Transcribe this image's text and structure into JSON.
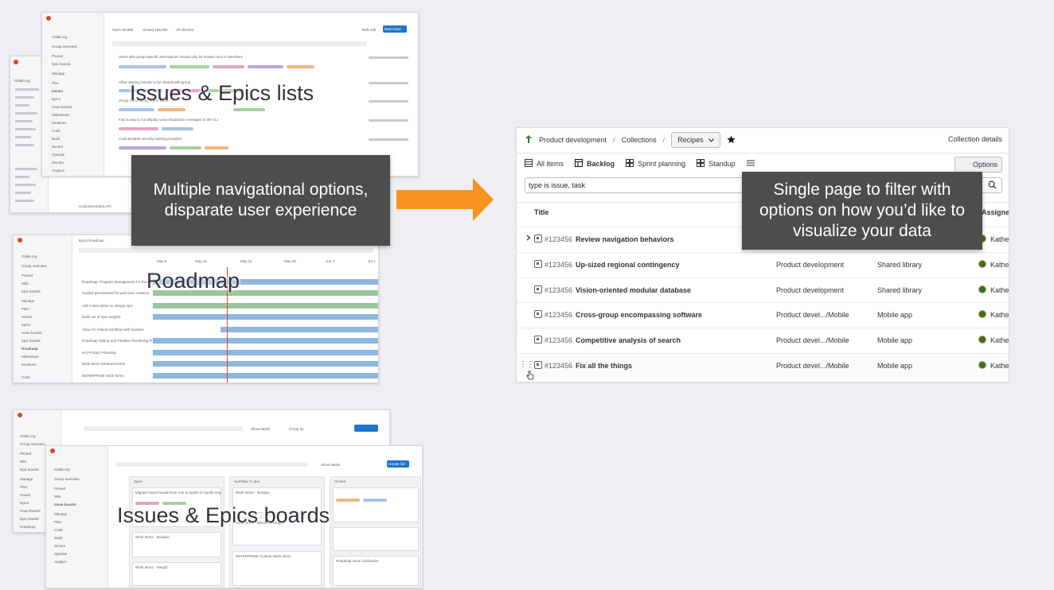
{
  "labels": {
    "issues_epics_lists": "Issues & Epics lists",
    "roadmap": "Roadmap",
    "issues_epics_boards": "Issues & Epics boards"
  },
  "callouts": {
    "left": "Multiple navigational options, disparate user experience",
    "right": "Single page to filter with options on how you’d like to visualize your data"
  },
  "colors": {
    "arrow": "#f7941d",
    "callout_bg": "#4d4d4d",
    "brand": "#e2432a",
    "accent_blue": "#1f75cb"
  },
  "mini_lists": {
    "sidebar_group": "Gitlab.org",
    "sidebar_items": [
      "Group overview",
      "Pinned",
      "Wiki",
      "Epic boards",
      "Manage",
      "Plan",
      "Issues",
      "Epics",
      "Issue boards",
      "Epic boards",
      "Roadmap",
      "Milestones",
      "Iterations",
      "Wiki",
      "Code",
      "Build",
      "Secure",
      "Operate",
      "Monitor",
      "Analyze"
    ],
    "header": {
      "new_issue_button": "New issue",
      "bulk_edit_button": "Bulk edit",
      "open_tab": "Open 85,888",
      "closed_tab": "Closed 168,056",
      "all_tab": "All 253,923"
    },
    "issue_titles": [
      "Users with group-specific permissions should only be shown once in Members",
      "Allow starting remote to be shared with group",
      "Group vulnerability report filters",
      "Find a way to not display some broadcast messages in the CLI",
      "Customizable security training providers",
      "Customers/Ultra API"
    ]
  },
  "mini_roadmap": {
    "title": "Epics Roadmap",
    "months": [
      "May 9",
      "May 16",
      "May 21",
      "May 28",
      "Jun 4",
      "Jul 1"
    ],
    "epics": [
      "Roadmap: Program Management for Roadmaps",
      "Guided permissions for work item creators",
      "Add a description to design epic",
      "Build out of epic weights",
      "Allow for refined workflow with lossless",
      "Roadmap Styling and Timeline Rendering Problems",
      "Hot Product Planning",
      "Work Items Enhancements",
      "ENTERPRISE Work Items"
    ]
  },
  "mini_boards": {
    "search_button": "Create list",
    "show_labels": "Show labels",
    "group_by": "Group by",
    "columns": [
      "Open",
      "workflow::in dev",
      "Closed"
    ],
    "cards": [
      "Migrate Issue boards from Vue to Apollo to Apollo only",
      "Work Items - Iteration",
      "Work Items - Milestone widget",
      "Work Items - Weight",
      "ENTERPRISE Custom Work Items",
      "Roadmap Issue Unification"
    ]
  },
  "panel": {
    "breadcrumb": {
      "group": "Product development",
      "section": "Collections",
      "current": "Recipes"
    },
    "collection_details": "Collection details",
    "tabs": [
      {
        "label": "All items",
        "active": false
      },
      {
        "label": "Backlog",
        "active": true
      },
      {
        "label": "Sprint planning",
        "active": false
      },
      {
        "label": "Standup",
        "active": false
      }
    ],
    "options_button": "Options",
    "filter_value": "type is issue, task",
    "columns": {
      "title": "Title",
      "assignee": "Assignee"
    },
    "rows": [
      {
        "id": "#123456",
        "title": "Review navigation behaviors",
        "group": "",
        "project": "",
        "assignee": "Kathe"
      },
      {
        "id": "#123456",
        "title": "Up-sized regional contingency",
        "group": "Product development",
        "project": "Shared library",
        "assignee": "Kathe"
      },
      {
        "id": "#123456",
        "title": "Vision-oriented modular database",
        "group": "Product development",
        "project": "Shared library",
        "assignee": "Kathe"
      },
      {
        "id": "#123456",
        "title": "Cross-group encompassing software",
        "group": "Product devel.../Mobile",
        "project": "Mobile app",
        "assignee": "Kathe"
      },
      {
        "id": "#123456",
        "title": "Competitive analysis of search",
        "group": "Product devel.../Mobile",
        "project": "Mobile app",
        "assignee": "Kathe"
      },
      {
        "id": "#123456",
        "title": "Fix all the things",
        "group": "Product devel.../Mobile",
        "project": "Mobile app",
        "assignee": "Kathe"
      }
    ]
  }
}
